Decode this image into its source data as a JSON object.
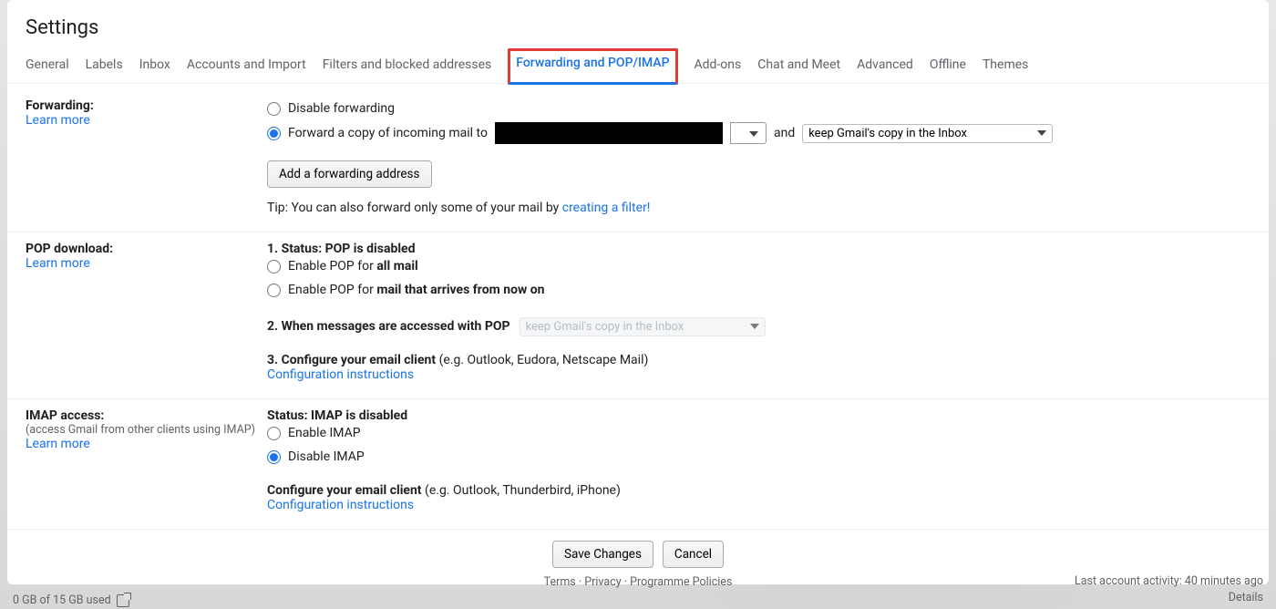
{
  "title": "Settings",
  "tabs": {
    "general": "General",
    "labels": "Labels",
    "inbox": "Inbox",
    "accounts": "Accounts and Import",
    "filters": "Filters and blocked addresses",
    "forwarding": "Forwarding and POP/IMAP",
    "addons": "Add-ons",
    "chat": "Chat and Meet",
    "advanced": "Advanced",
    "offline": "Offline",
    "themes": "Themes"
  },
  "forwarding": {
    "heading": "Forwarding:",
    "learn": "Learn more",
    "disable": "Disable forwarding",
    "forward_prefix": "Forward a copy of incoming mail to",
    "and": "and",
    "keep_copy": "keep Gmail's copy in the Inbox",
    "add_btn": "Add a forwarding address",
    "tip_prefix": "Tip: You can also forward only some of your mail by ",
    "tip_link": "creating a filter!"
  },
  "pop": {
    "heading": "POP download:",
    "learn": "Learn more",
    "status_label": "1. Status: ",
    "status_value": "POP is disabled",
    "enable_all_prefix": "Enable POP for ",
    "enable_all_bold": "all mail",
    "enable_now_prefix": "Enable POP for ",
    "enable_now_bold": "mail that arrives from now on",
    "when_label": "2. When messages are accessed with POP",
    "when_select": "keep Gmail's copy in the Inbox",
    "configure_label": "3. Configure your email client ",
    "configure_hint": "(e.g. Outlook, Eudora, Netscape Mail)",
    "config_link": "Configuration instructions"
  },
  "imap": {
    "heading": "IMAP access:",
    "sub": "(access Gmail from other clients using IMAP)",
    "learn": "Learn more",
    "status_label": "Status: ",
    "status_value": "IMAP is disabled",
    "enable": "Enable IMAP",
    "disable": "Disable IMAP",
    "configure_label": "Configure your email client ",
    "configure_hint": "(e.g. Outlook, Thunderbird, iPhone)",
    "config_link": "Configuration instructions"
  },
  "actions": {
    "save": "Save Changes",
    "cancel": "Cancel"
  },
  "footer": {
    "storage": "0 GB of 15 GB used",
    "terms": "Terms",
    "privacy": "Privacy",
    "policies": "Programme Policies",
    "activity": "Last account activity: 40 minutes ago",
    "details": "Details"
  }
}
